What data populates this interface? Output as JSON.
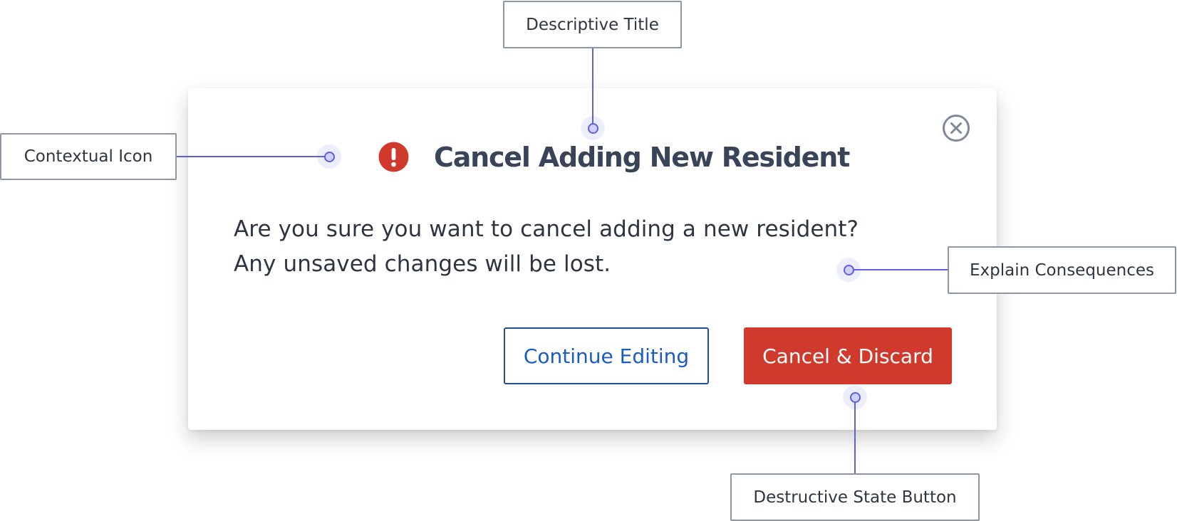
{
  "dialog": {
    "title": "Cancel Adding New Resident",
    "message": "Are you sure you want to cancel adding a new resident? Any unsaved changes will be lost.",
    "continue_label": "Continue Editing",
    "discard_label": "Cancel & Discard",
    "icon": "alert-circle-icon",
    "close_icon": "close-circle-icon"
  },
  "annotations": {
    "descriptive_title": "Descriptive Title",
    "contextual_icon": "Contextual Icon",
    "explain_consequences": "Explain Consequences",
    "destructive_state_button": "Destructive State Button"
  },
  "colors": {
    "destructive": "#d03a2d",
    "primary_link": "#1a5bc4",
    "annotation_line": "#5b5fe0",
    "title_text": "#3a4458"
  }
}
